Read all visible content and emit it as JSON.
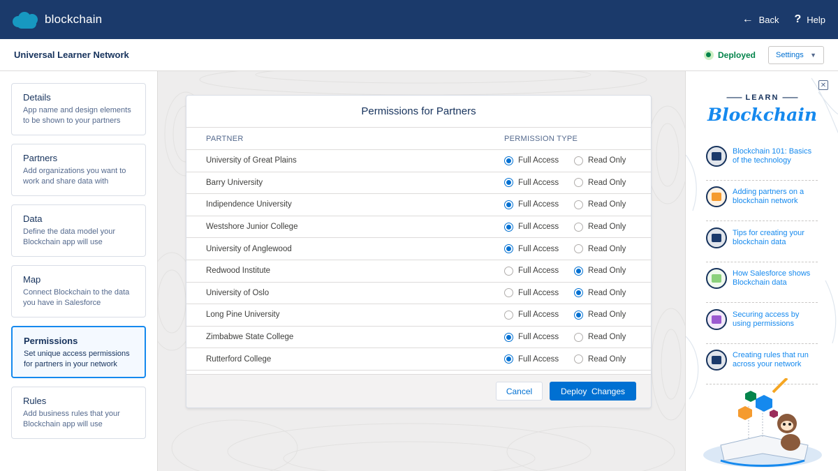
{
  "topbar": {
    "brand": "blockchain",
    "back_label": "Back",
    "help_label": "Help"
  },
  "subbar": {
    "title": "Universal Learner Network",
    "status": "Deployed",
    "settings_label": "Settings"
  },
  "steps": [
    {
      "title": "Details",
      "desc": "App name and design elements to be shown to your partners",
      "active": false
    },
    {
      "title": "Partners",
      "desc": "Add organizations you want to work and share data with",
      "active": false
    },
    {
      "title": "Data",
      "desc": "Define the data model your Blockchain app will use",
      "active": false
    },
    {
      "title": "Map",
      "desc": "Connect Blockchain to the data you have in Salesforce",
      "active": false
    },
    {
      "title": "Permissions",
      "desc": "Set unique access permissions for partners in your network",
      "active": true
    },
    {
      "title": "Rules",
      "desc": "Add business rules that your Blockchain app will use",
      "active": false
    }
  ],
  "permissions": {
    "title": "Permissions for Partners",
    "col_partner": "PARTNER",
    "col_type": "PERMISSION TYPE",
    "option_full": "Full Access",
    "option_read": "Read Only",
    "rows": [
      {
        "partner": "University of Great Plains",
        "selected": "full"
      },
      {
        "partner": "Barry University",
        "selected": "full"
      },
      {
        "partner": "Indipendence University",
        "selected": "full"
      },
      {
        "partner": "Westshore Junior College",
        "selected": "full"
      },
      {
        "partner": "University of Anglewood",
        "selected": "full"
      },
      {
        "partner": "Redwood Institute",
        "selected": "read"
      },
      {
        "partner": "University of Oslo",
        "selected": "read"
      },
      {
        "partner": "Long Pine University",
        "selected": "read"
      },
      {
        "partner": "Zimbabwe State College",
        "selected": "full"
      },
      {
        "partner": "Rutterford College",
        "selected": "full"
      }
    ],
    "cancel_label": "Cancel",
    "deploy_label": "Deploy  Changes"
  },
  "learn": {
    "kicker": "LEARN",
    "title": "Blockchain",
    "topics": [
      {
        "label": "Blockchain 101: Basics of the technology",
        "icon": "robot-icon",
        "color": "#1b3a6b"
      },
      {
        "label": "Adding partners on a blockchain network",
        "icon": "id-card-icon",
        "color": "#f59b2f"
      },
      {
        "label": "Tips for creating your blockchain data",
        "icon": "pen-icon",
        "color": "#1b3a6b"
      },
      {
        "label": "How Salesforce shows Blockchain data",
        "icon": "window-icon",
        "color": "#8bd17c"
      },
      {
        "label": "Securing access by using permissions",
        "icon": "phone-lock-icon",
        "color": "#9b59d0"
      },
      {
        "label": "Creating rules that run across your network",
        "icon": "ship-icon",
        "color": "#1b3a6b"
      }
    ]
  },
  "colors": {
    "brand_bar": "#1b3a6b",
    "accent": "#0070d2",
    "deployed": "#04844b"
  }
}
